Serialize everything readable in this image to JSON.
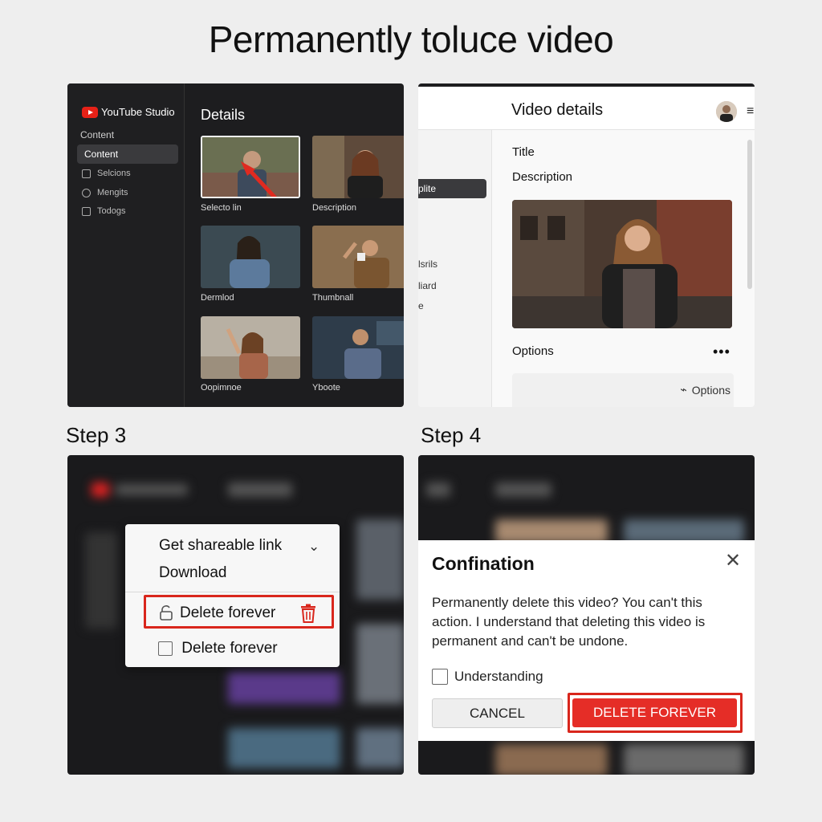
{
  "title": "Permanently toluce video",
  "steps": {
    "step3": "Step 3",
    "step4": "Step 4"
  },
  "panel1": {
    "logo": "YouTube Studio",
    "nav_header": "Content",
    "nav_active": "Content",
    "nav_items": [
      "Selcions",
      "Mengits",
      "Todogs"
    ],
    "heading": "Details",
    "thumbnails": [
      "Selecto lin",
      "Description",
      "Dermlod",
      "Thumbnall",
      "Oopimnoe",
      "Yboote"
    ]
  },
  "panel2": {
    "header_title": "Video details",
    "left_items": [
      "plite",
      "lsrils",
      "liard",
      "e"
    ],
    "title_label": "Title",
    "description_label": "Description",
    "options_label": "Options",
    "options_button": "Options",
    "more_icon": "more-horizontal-icon"
  },
  "panel3": {
    "menu_items": [
      "Get shareable link",
      "Download",
      "Delete forever",
      "Delete forever"
    ]
  },
  "panel4": {
    "dialog_title": "Confination",
    "message": "Permanently delete this video? You can't this action. I understand that deleting this video is permanent and can't be undone.",
    "checkbox_label": "Understanding",
    "cancel": "CANCEL",
    "confirm": "DELETE FOREVER"
  },
  "colors": {
    "accent_red": "#e52d27",
    "highlight_red": "#d9261c",
    "dark_bg": "#1d1d1f"
  }
}
